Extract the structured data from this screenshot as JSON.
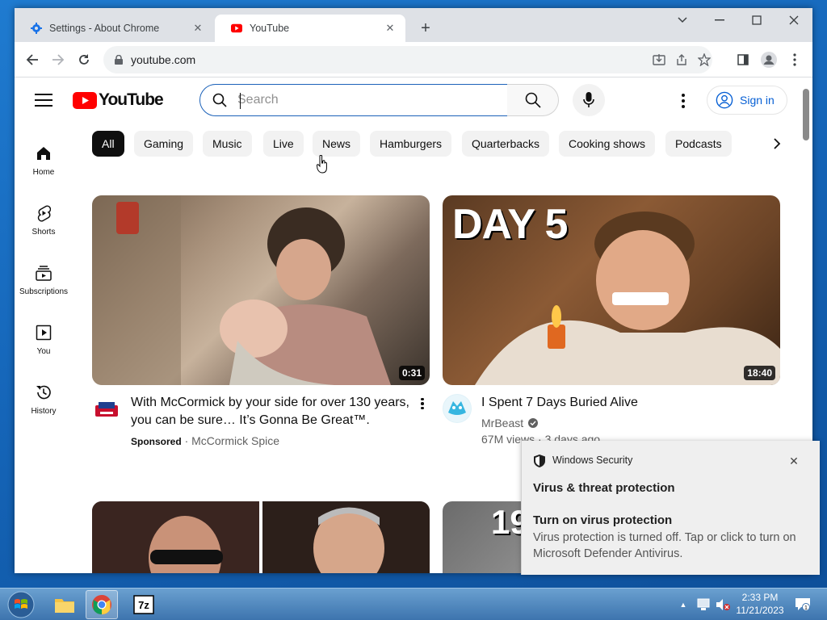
{
  "browser": {
    "tabs": [
      {
        "label": "Settings - About Chrome",
        "active": false
      },
      {
        "label": "YouTube",
        "active": true
      }
    ],
    "url": "youtube.com"
  },
  "youtube": {
    "search_placeholder": "Search",
    "sign_in": "Sign in",
    "sidebar": [
      {
        "label": "Home",
        "icon": "home-icon"
      },
      {
        "label": "Shorts",
        "icon": "shorts-icon"
      },
      {
        "label": "Subscriptions",
        "icon": "subscriptions-icon"
      },
      {
        "label": "You",
        "icon": "you-icon"
      },
      {
        "label": "History",
        "icon": "history-icon"
      }
    ],
    "chips": [
      "All",
      "Gaming",
      "Music",
      "Live",
      "News",
      "Hamburgers",
      "Quarterbacks",
      "Cooking shows",
      "Podcasts"
    ],
    "videos": [
      {
        "title_line1": "With McCormick by your side for over 130 years,",
        "title_line2": "you can be sure… It’s Gonna Be Great™.",
        "sponsored": "Sponsored",
        "separator": "·",
        "channel": "McCormick Spice",
        "duration": "0:31"
      },
      {
        "title": "I Spent 7 Days Buried Alive",
        "channel": "MrBeast",
        "views": "67M views",
        "separator": "·",
        "age": "3 days ago",
        "duration": "18:40",
        "thumb_text": "DAY 5"
      }
    ],
    "partial_thumb_text": "19"
  },
  "notification": {
    "app": "Windows Security",
    "heading": "Virus & threat protection",
    "subheading": "Turn on virus protection",
    "body": "Virus protection is turned off. Tap or click to turn on Microsoft Defender Antivirus."
  },
  "taskbar": {
    "time": "2:33 PM",
    "date": "11/21/2023",
    "notification_count": "1"
  },
  "colors": {
    "youtube_red": "#ff0000",
    "link_blue": "#065fd4",
    "chrome_tab_bg": "#dee1e6"
  }
}
